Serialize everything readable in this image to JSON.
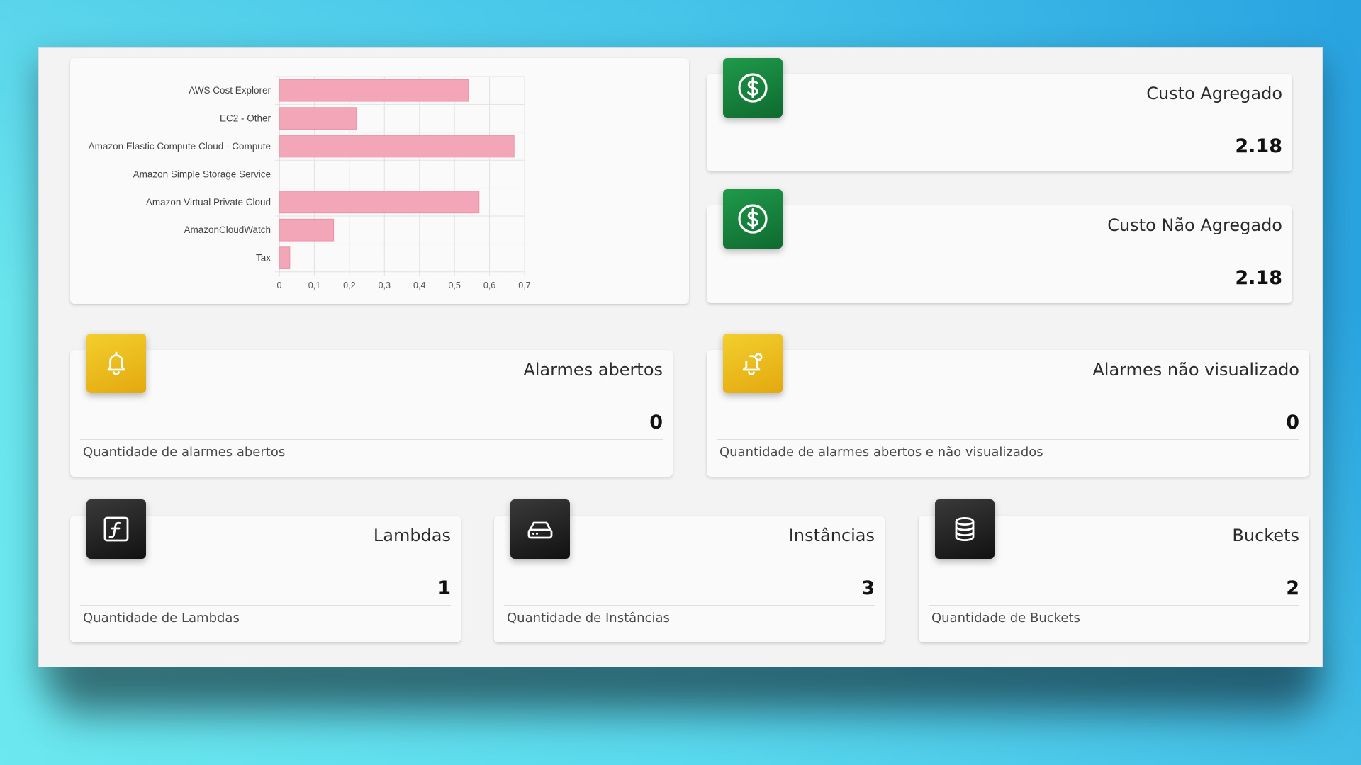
{
  "chart_data": {
    "type": "bar",
    "orientation": "horizontal",
    "categories": [
      "AWS Cost Explorer",
      "EC2 - Other",
      "Amazon Elastic Compute Cloud - Compute",
      "Amazon Simple Storage Service",
      "Amazon Virtual Private Cloud",
      "AmazonCloudWatch",
      "Tax"
    ],
    "values": [
      0.54,
      0.22,
      0.67,
      0.0,
      0.57,
      0.155,
      0.03
    ],
    "xticks": [
      "0",
      "0,1",
      "0,2",
      "0,3",
      "0,4",
      "0,5",
      "0,6",
      "0,7"
    ],
    "xlim": [
      0,
      0.7
    ],
    "grid": true,
    "bar_color": "#f2a6b8"
  },
  "cost_aggregated": {
    "title": "Custo Agregado",
    "value": "2.18",
    "icon": "dollar-icon"
  },
  "cost_not_aggregated": {
    "title": "Custo Não Agregado",
    "value": "2.18",
    "icon": "dollar-icon"
  },
  "alarms_open": {
    "title": "Alarmes abertos",
    "value": "0",
    "footer": "Quantidade de alarmes abertos",
    "icon": "bell-icon"
  },
  "alarms_unseen": {
    "title": "Alarmes não visualizado",
    "value": "0",
    "footer": "Quantidade de alarmes abertos e não visualizados",
    "icon": "bell-alert-icon"
  },
  "lambdas": {
    "title": "Lambdas",
    "value": "1",
    "footer": "Quantidade de Lambdas",
    "icon": "function-icon"
  },
  "instances": {
    "title": "Instâncias",
    "value": "3",
    "footer": "Quantidade de Instâncias",
    "icon": "server-drive-icon"
  },
  "buckets": {
    "title": "Buckets",
    "value": "2",
    "footer": "Quantidade de Buckets",
    "icon": "database-icon"
  },
  "colors": {
    "green": "#1a8a42",
    "yellow": "#edbf1f",
    "dark": "#222222"
  }
}
